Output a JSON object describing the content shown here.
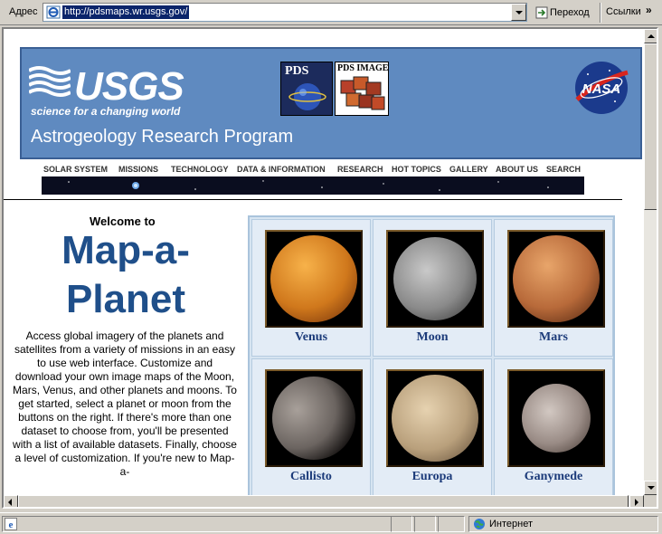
{
  "addressbar": {
    "label": "Адрес",
    "url": "http://pdsmaps.wr.usgs.gov/",
    "go_label": "Переход",
    "links_label": "Ссылки",
    "links_chevron": "»"
  },
  "header": {
    "usgs_logo_text": "USGS",
    "usgs_tagline": "science for a changing world",
    "pds_logo_text": "PDS",
    "pds_image_logo_text": "PDS IMAGE",
    "nasa_logo_text": "NASA",
    "program_title": "Astrogeology Research Program"
  },
  "nav": {
    "items": [
      "SOLAR SYSTEM",
      "MISSIONS",
      "TECHNOLOGY",
      "DATA & INFORMATION",
      "RESEARCH",
      "HOT TOPICS",
      "GALLERY",
      "ABOUT US",
      "SEARCH"
    ]
  },
  "main": {
    "welcome": "Welcome to",
    "title": "Map-a-Planet",
    "intro": "Access global imagery of the planets and satellites from a variety of missions in an easy to use web interface. Customize and download your own image maps of the Moon, Mars, Venus, and other planets and moons. To get started, select a planet or moon from the buttons on the right. If there's more than one dataset to choose from, you'll be presented with a list of available datasets. Finally, choose a level of customization. If you're new to Map-a-"
  },
  "planets": [
    {
      "name": "Venus",
      "color": "#d0781c"
    },
    {
      "name": "Moon",
      "color": "#8a8a8a"
    },
    {
      "name": "Mars",
      "color": "#b86a3a"
    },
    {
      "name": "Callisto",
      "color": "#6b6460"
    },
    {
      "name": "Europa",
      "color": "#b9a07c"
    },
    {
      "name": "Ganymede",
      "color": "#9a8c86"
    }
  ],
  "statusbar": {
    "zone": "Интернет"
  }
}
